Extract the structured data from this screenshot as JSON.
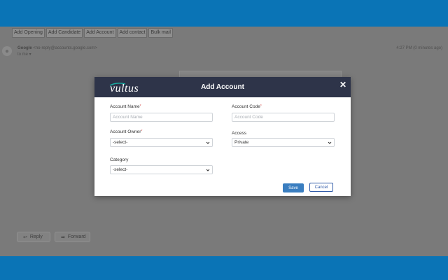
{
  "toolbar": {
    "buttons": [
      "Add Opening",
      "Add Candidate",
      "Add Account",
      "Add contact",
      "Bulk mail"
    ]
  },
  "email": {
    "sender_name": "Google",
    "sender_email": "<no-reply@accounts.google.com>",
    "to": "to me ▾",
    "timestamp": "4:27 PM (0 minutes ago)",
    "reply_label": "Reply",
    "forward_label": "Forward"
  },
  "modal": {
    "logo_text": "vultus",
    "title": "Add Account",
    "close_glyph": "✕",
    "fields": {
      "account_name": {
        "label": "Account Name",
        "required": "*",
        "placeholder": "Account Name"
      },
      "account_code": {
        "label": "Account Code",
        "required": "*",
        "placeholder": "Account Code"
      },
      "account_owner": {
        "label": "Account Owner",
        "required": "*",
        "value": "-select-"
      },
      "access": {
        "label": "Access",
        "value": "Private"
      },
      "category": {
        "label": "Category",
        "value": "-select-"
      }
    },
    "save_label": "Save",
    "cancel_label": "Cancel"
  },
  "colors": {
    "brand_band": "#0a74b6",
    "modal_header": "#2e3449",
    "save_button": "#3a7ec0",
    "cancel_border": "#2f5aa8",
    "logo_accent": "#1aa99f"
  }
}
